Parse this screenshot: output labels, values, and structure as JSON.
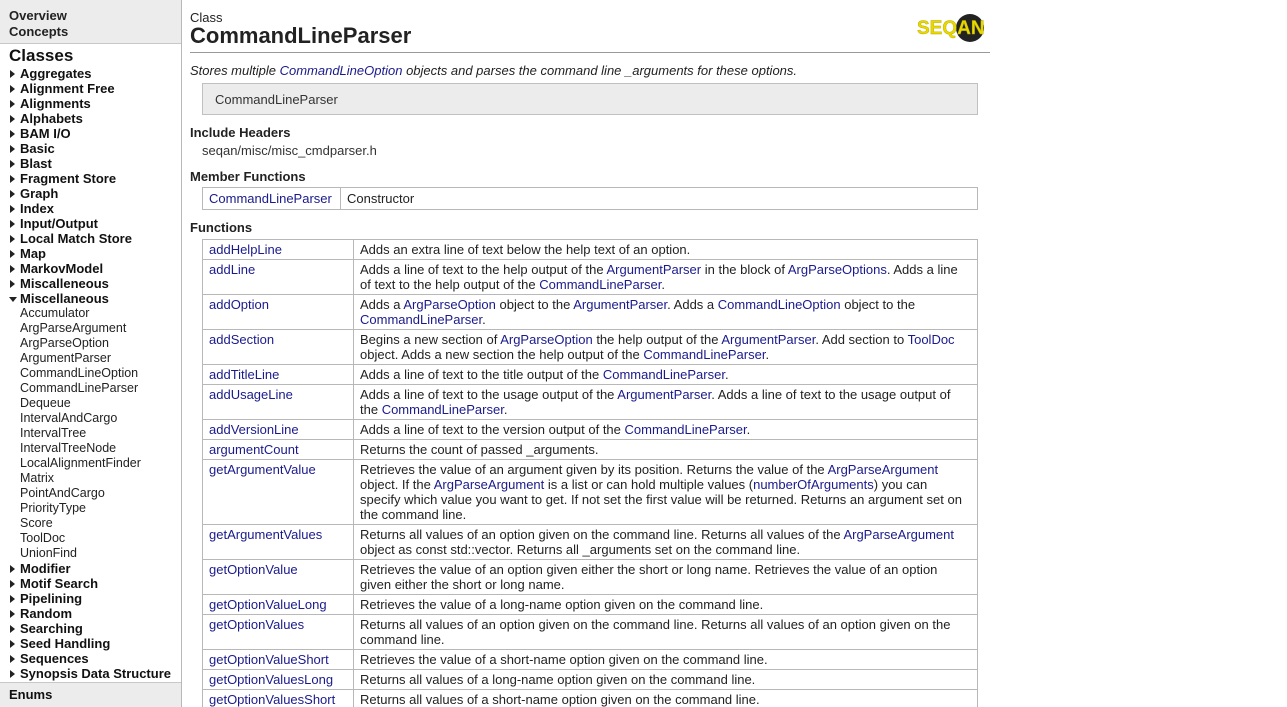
{
  "sidebar": {
    "top_links": [
      "Overview",
      "Concepts"
    ],
    "classes_heading": "Classes",
    "categories": [
      {
        "label": "Aggregates",
        "open": false
      },
      {
        "label": "Alignment Free",
        "open": false
      },
      {
        "label": "Alignments",
        "open": false
      },
      {
        "label": "Alphabets",
        "open": false
      },
      {
        "label": "BAM I/O",
        "open": false
      },
      {
        "label": "Basic",
        "open": false
      },
      {
        "label": "Blast",
        "open": false
      },
      {
        "label": "Fragment Store",
        "open": false
      },
      {
        "label": "Graph",
        "open": false
      },
      {
        "label": "Index",
        "open": false
      },
      {
        "label": "Input/Output",
        "open": false
      },
      {
        "label": "Local Match Store",
        "open": false
      },
      {
        "label": "Map",
        "open": false
      },
      {
        "label": "MarkovModel",
        "open": false
      },
      {
        "label": "Miscalleneous",
        "open": false
      },
      {
        "label": "Miscellaneous",
        "open": true,
        "children": [
          "Accumulator",
          "ArgParseArgument",
          "ArgParseOption",
          "ArgumentParser",
          "CommandLineOption",
          "CommandLineParser",
          "Dequeue",
          "IntervalAndCargo",
          "IntervalTree",
          "IntervalTreeNode",
          "LocalAlignmentFinder",
          "Matrix",
          "PointAndCargo",
          "PriorityType",
          "Score",
          "ToolDoc",
          "UnionFind"
        ]
      },
      {
        "label": "Modifier",
        "open": false
      },
      {
        "label": "Motif Search",
        "open": false
      },
      {
        "label": "Pipelining",
        "open": false
      },
      {
        "label": "Random",
        "open": false
      },
      {
        "label": "Searching",
        "open": false
      },
      {
        "label": "Seed Handling",
        "open": false
      },
      {
        "label": "Sequences",
        "open": false
      },
      {
        "label": "Synopsis Data Structure",
        "open": false
      }
    ],
    "enums_label": "Enums"
  },
  "main": {
    "class_label": "Class",
    "title": "CommandLineParser",
    "logo_text": "SEQAN",
    "description": [
      {
        "t": "Stores multiple "
      },
      {
        "t": "CommandLineOption",
        "link": true
      },
      {
        "t": " objects and parses the command line _arguments for these options."
      }
    ],
    "signature": "CommandLineParser",
    "include_heading": "Include Headers",
    "include_path": "seqan/misc/misc_cmdparser.h",
    "members_heading": "Member Functions",
    "members": [
      {
        "name": "CommandLineParser",
        "desc": "Constructor"
      }
    ],
    "functions_heading": "Functions",
    "functions": [
      {
        "name": "addHelpLine",
        "desc": [
          {
            "t": "Adds an extra line of text below the help text of an option."
          }
        ]
      },
      {
        "name": "addLine",
        "desc": [
          {
            "t": "Adds a line of text to the help output of the "
          },
          {
            "t": "ArgumentParser",
            "link": true
          },
          {
            "t": " in the block of "
          },
          {
            "t": "ArgParseOptions",
            "link": true
          },
          {
            "t": ". Adds a line of text to the help output of the "
          },
          {
            "t": "CommandLineParser",
            "link": true
          },
          {
            "t": "."
          }
        ]
      },
      {
        "name": "addOption",
        "desc": [
          {
            "t": "Adds a "
          },
          {
            "t": "ArgParseOption",
            "link": true
          },
          {
            "t": " object to the "
          },
          {
            "t": "ArgumentParser",
            "link": true
          },
          {
            "t": ". Adds a "
          },
          {
            "t": "CommandLineOption",
            "link": true
          },
          {
            "t": " object to the "
          },
          {
            "t": "CommandLineParser",
            "link": true
          },
          {
            "t": "."
          }
        ]
      },
      {
        "name": "addSection",
        "desc": [
          {
            "t": "Begins a new section of "
          },
          {
            "t": "ArgParseOption",
            "link": true
          },
          {
            "t": " the help output of the "
          },
          {
            "t": "ArgumentParser",
            "link": true
          },
          {
            "t": ". Add section to "
          },
          {
            "t": "ToolDoc",
            "link": true
          },
          {
            "t": " object. Adds a new section the help output of the "
          },
          {
            "t": "CommandLineParser",
            "link": true
          },
          {
            "t": "."
          }
        ]
      },
      {
        "name": "addTitleLine",
        "desc": [
          {
            "t": "Adds a line of text to the title output of the "
          },
          {
            "t": "CommandLineParser",
            "link": true
          },
          {
            "t": "."
          }
        ]
      },
      {
        "name": "addUsageLine",
        "desc": [
          {
            "t": "Adds a line of text to the usage output of the "
          },
          {
            "t": "ArgumentParser",
            "link": true
          },
          {
            "t": ". Adds a line of text to the usage output of the "
          },
          {
            "t": "CommandLineParser",
            "link": true
          },
          {
            "t": "."
          }
        ]
      },
      {
        "name": "addVersionLine",
        "desc": [
          {
            "t": "Adds a line of text to the version output of the "
          },
          {
            "t": "CommandLineParser",
            "link": true
          },
          {
            "t": "."
          }
        ]
      },
      {
        "name": "argumentCount",
        "desc": [
          {
            "t": "Returns the count of passed _arguments."
          }
        ]
      },
      {
        "name": "getArgumentValue",
        "desc": [
          {
            "t": "Retrieves the value of an argument given by its position. Returns the value of the "
          },
          {
            "t": "ArgParseArgument",
            "link": true
          },
          {
            "t": " object. If the "
          },
          {
            "t": "ArgParseArgument",
            "link": true
          },
          {
            "t": " is a list or can hold multiple values ("
          },
          {
            "t": "numberOfArguments",
            "link": true
          },
          {
            "t": ") you can specify which value you want to get. If not set the first value will be returned. Returns an argument set on the command line."
          }
        ]
      },
      {
        "name": "getArgumentValues",
        "desc": [
          {
            "t": "Returns all values of an option given on the command line. Returns all values of the "
          },
          {
            "t": "ArgParseArgument",
            "link": true
          },
          {
            "t": " object as const std::vector. Returns all _arguments set on the command line."
          }
        ]
      },
      {
        "name": "getOptionValue",
        "desc": [
          {
            "t": "Retrieves the value of an option given either the short or long name. Retrieves the value of an option given either the short or long name."
          }
        ]
      },
      {
        "name": "getOptionValueLong",
        "desc": [
          {
            "t": "Retrieves the value of a long-name option given on the command line."
          }
        ]
      },
      {
        "name": "getOptionValues",
        "desc": [
          {
            "t": "Returns all values of an option given on the command line. Returns all values of an option given on the command line."
          }
        ]
      },
      {
        "name": "getOptionValueShort",
        "desc": [
          {
            "t": "Retrieves the value of a short-name option given on the command line."
          }
        ]
      },
      {
        "name": "getOptionValuesLong",
        "desc": [
          {
            "t": "Returns all values of a long-name option given on the command line."
          }
        ]
      },
      {
        "name": "getOptionValuesShort",
        "desc": [
          {
            "t": "Returns all values of a short-name option given on the command line."
          }
        ]
      },
      {
        "name": "",
        "desc": [
          {
            "t": ""
          }
        ]
      }
    ]
  }
}
